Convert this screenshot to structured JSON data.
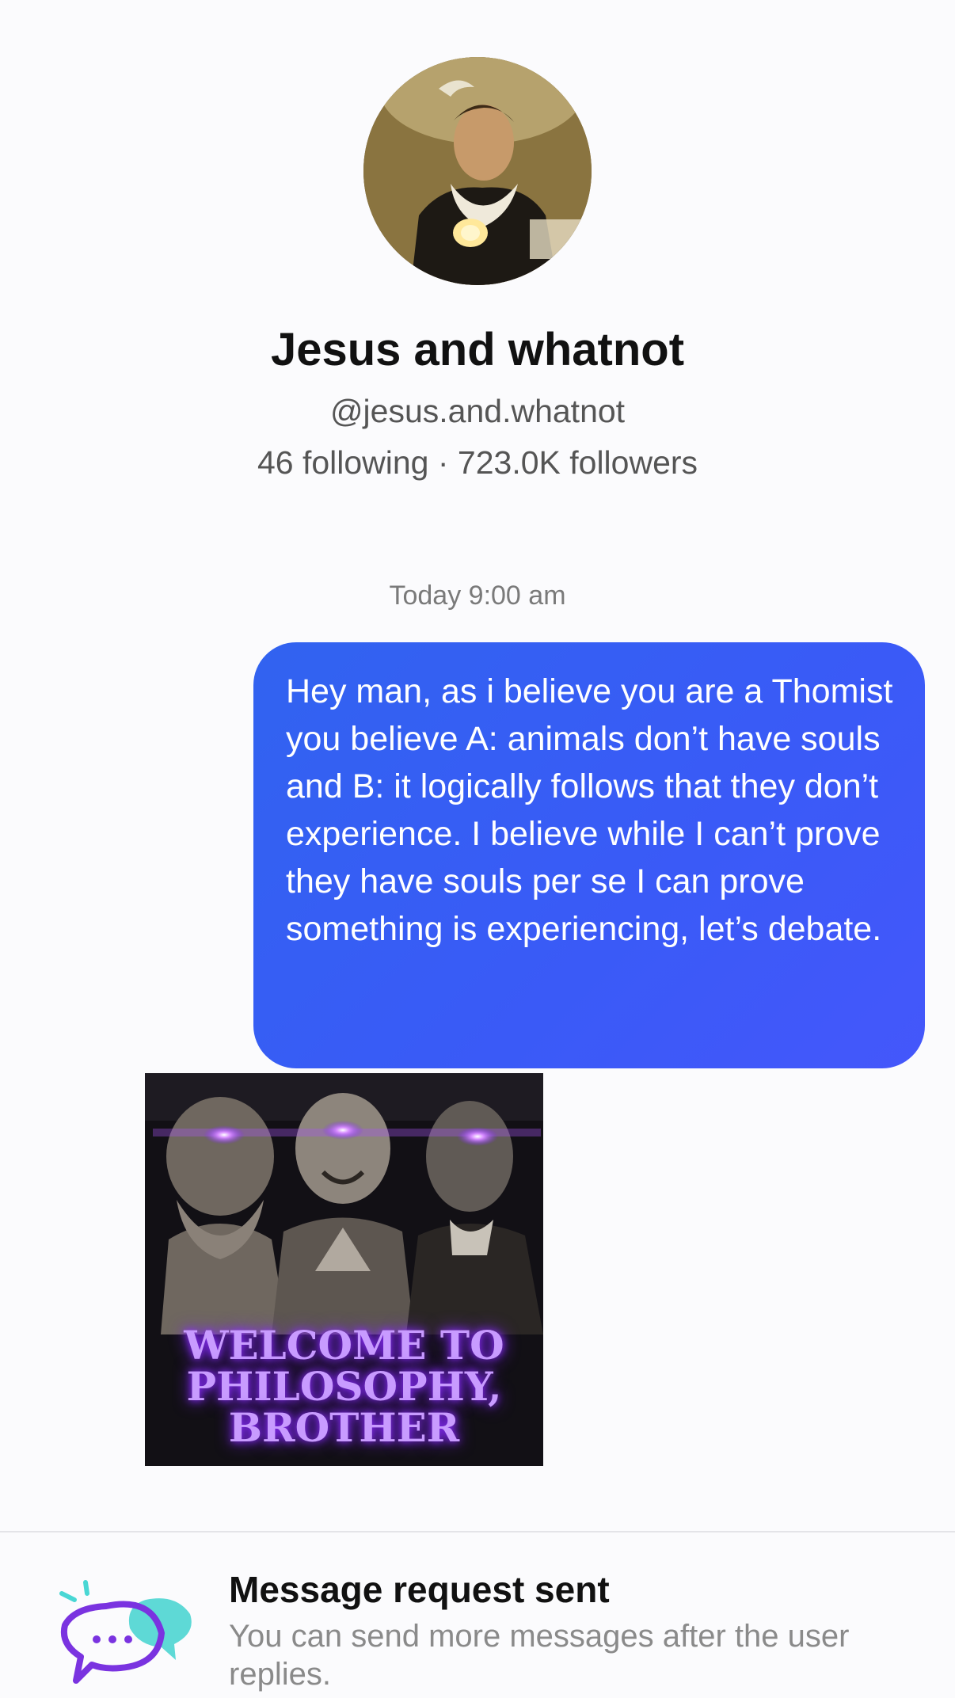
{
  "profile": {
    "name": "Jesus and whatnot",
    "handle": "@jesus.and.whatnot",
    "stats": "46 following · 723.0K followers"
  },
  "chat": {
    "timestamp": "Today 9:00 am",
    "messages": [
      {
        "type": "text",
        "sender": "me",
        "text": "Hey man, as i believe you are a Thomist you believe A: animals don’t have souls and B: it logically follows that they don’t experience. I believe while I can’t prove they have souls per se I can prove something is experiencing, let’s debate."
      },
      {
        "type": "image",
        "caption": "WELCOME TO\nPHILOSOPHY,\nBROTHER"
      }
    ]
  },
  "notice": {
    "icon": "chat-bubbles-icon",
    "title": "Message request sent",
    "subtitle": "You can send more messages after the user replies."
  },
  "colors": {
    "bubble": "#3a5cf5",
    "glow": "#a855f7"
  }
}
